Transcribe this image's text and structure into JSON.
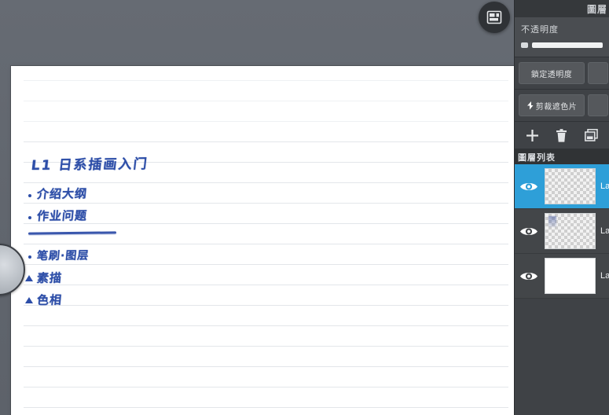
{
  "panel": {
    "title": "圖層",
    "opacity_label": "不透明度",
    "opacity_value": "100",
    "buttons": {
      "lock_alpha": "鎖定透明度",
      "clipping_mask": "剪裁遮色片",
      "clipping_icon": "clip-arrow-icon"
    },
    "tools": {
      "add": "+",
      "delete": "trash-icon",
      "duplicate": "duplicate-icon"
    },
    "layer_list_title": "圖層列表",
    "layers": [
      {
        "name": "Lay",
        "visible": "eye-icon",
        "selected": true,
        "thumb": "checker"
      },
      {
        "name": "Lay",
        "visible": "eye-icon",
        "selected": false,
        "thumb": "checker-marked"
      },
      {
        "name": "Lay",
        "visible": "eye-icon",
        "selected": false,
        "thumb": "white"
      }
    ]
  },
  "toolbar": {
    "panel_toggle": "layout-panel-icon"
  },
  "notebook": {
    "title": "L1 日系插画入门",
    "lines": [
      {
        "bullet": "dot",
        "text": "介绍大纲"
      },
      {
        "bullet": "dot",
        "text": "作业问题"
      },
      {
        "bullet": "dot",
        "text": "笔刷·图层"
      },
      {
        "bullet": "triangle",
        "text": "素描"
      },
      {
        "bullet": "triangle",
        "text": "色相"
      }
    ]
  },
  "colors": {
    "accent_blue": "#2e9fd8",
    "ink_blue": "#2d4ea8",
    "panel_bg": "#3f4246",
    "canvas_bg": "#656a72"
  }
}
